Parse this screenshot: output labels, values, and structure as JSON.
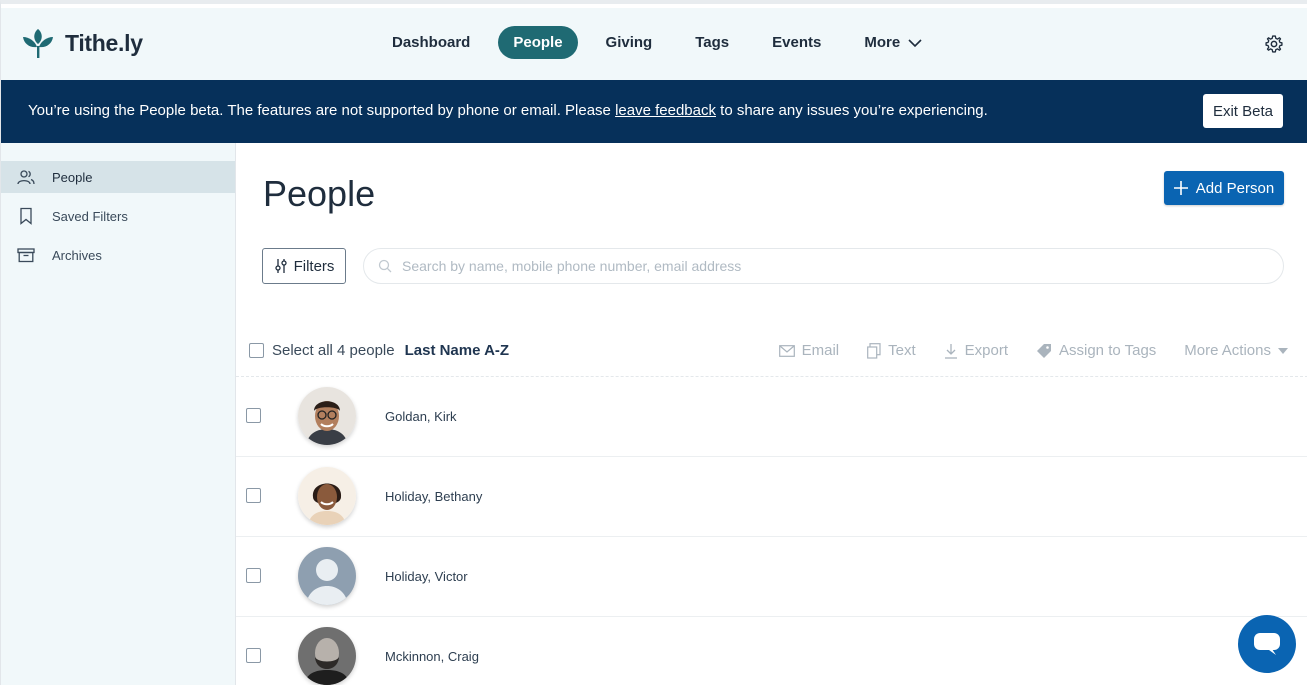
{
  "app": {
    "name": "Tithe.ly"
  },
  "nav": {
    "items": [
      {
        "label": "Dashboard",
        "active": false
      },
      {
        "label": "People",
        "active": true
      },
      {
        "label": "Giving",
        "active": false
      },
      {
        "label": "Tags",
        "active": false
      },
      {
        "label": "Events",
        "active": false
      },
      {
        "label": "More",
        "active": false
      }
    ],
    "settings_icon": "gear-icon"
  },
  "banner": {
    "text_before": "You’re using the People beta. The features are not supported by phone or email. Please ",
    "link": "leave feedback",
    "text_after": " to share any issues you’re experiencing.",
    "exit_label": "Exit Beta"
  },
  "sidebar": {
    "items": [
      {
        "label": "People",
        "icon": "people-icon",
        "active": true
      },
      {
        "label": "Saved Filters",
        "icon": "bookmark-icon",
        "active": false
      },
      {
        "label": "Archives",
        "icon": "archive-icon",
        "active": false
      }
    ]
  },
  "main": {
    "title": "People",
    "add_label": "Add Person",
    "filters_label": "Filters",
    "search": {
      "placeholder": "Search by name, mobile phone number, email address",
      "value": ""
    },
    "select_all_label": "Select all 4 people",
    "sort_label": "Last Name A-Z",
    "actions": {
      "email": "Email",
      "text": "Text",
      "export": "Export",
      "tags": "Assign to Tags",
      "more": "More Actions"
    },
    "people": [
      {
        "name": "Goldan, Kirk"
      },
      {
        "name": "Holiday, Bethany"
      },
      {
        "name": "Holiday, Victor"
      },
      {
        "name": "Mckinnon, Craig"
      }
    ]
  },
  "colors": {
    "brand": "#1f6a73",
    "banner": "#06305a",
    "primary": "#0a64b2",
    "sidebar_bg": "#f1f8fa"
  }
}
